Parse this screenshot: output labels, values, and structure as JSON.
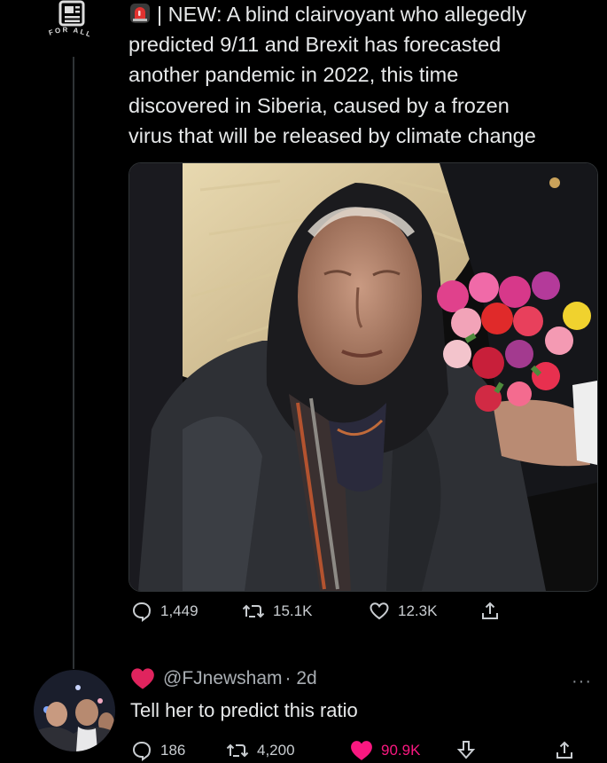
{
  "tweet": {
    "avatar_label": "FOR ALL",
    "text_prefix": "| NEW:",
    "text": " A blind clairvoyant who allegedly\npredicted 9/11 and Brexit has forecasted\nanother pandemic in 2022, this time\ndiscovered in Siberia, caused by a frozen\nvirus that will be released by climate change",
    "replies": "1,449",
    "retweets": "15.1K",
    "likes": "12.3K"
  },
  "reply": {
    "handle": "@FJnewsham",
    "time": "· 2d",
    "text": "Tell her to predict this ratio",
    "replies": "186",
    "retweets": "4,200",
    "likes": "90.9K",
    "more": "···"
  },
  "colors": {
    "like_pink": "#f91880",
    "heart_red": "#e0245e",
    "siren_red": "#e0322f"
  }
}
